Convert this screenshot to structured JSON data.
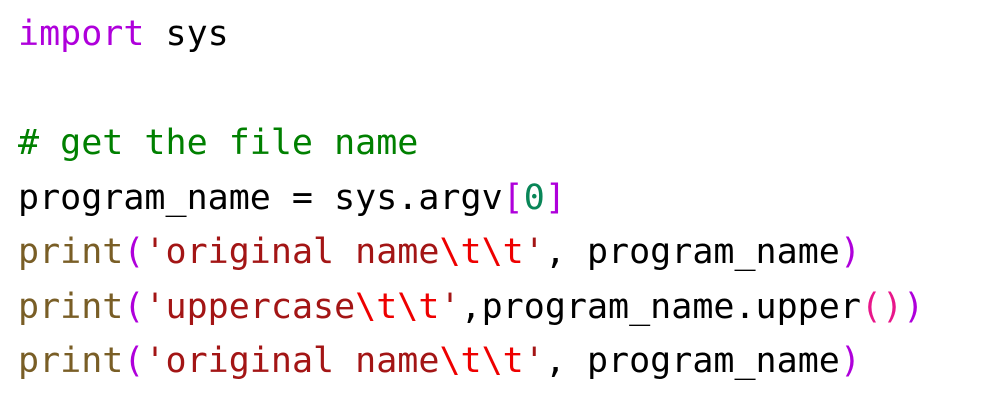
{
  "colors": {
    "background": "#ffffff",
    "default": "#000000",
    "keyword": "#af00db",
    "builtin": "#795e26",
    "string": "#a31515",
    "escape": "#ee0000",
    "comment": "#008000",
    "number": "#098658",
    "bracket_level1": "#af00db",
    "bracket_level2": "#e8178a",
    "partial_line": "#bfbfbf"
  },
  "lines": [
    {
      "tokens": [
        {
          "text": "import",
          "type": "keyword"
        },
        {
          "text": " sys",
          "type": "default"
        }
      ]
    },
    {
      "tokens": []
    },
    {
      "tokens": [
        {
          "text": "# get the file name",
          "type": "comment"
        }
      ]
    },
    {
      "tokens": [
        {
          "text": "program_name = sys.argv",
          "type": "default"
        },
        {
          "text": "[",
          "type": "bracket_level1"
        },
        {
          "text": "0",
          "type": "number"
        },
        {
          "text": "]",
          "type": "bracket_level1"
        }
      ]
    },
    {
      "tokens": [
        {
          "text": "print",
          "type": "builtin"
        },
        {
          "text": "(",
          "type": "bracket_level1"
        },
        {
          "text": "'original name",
          "type": "string"
        },
        {
          "text": "\\t\\t",
          "type": "escape"
        },
        {
          "text": "'",
          "type": "string"
        },
        {
          "text": ", program_name",
          "type": "default"
        },
        {
          "text": ")",
          "type": "bracket_level1"
        }
      ]
    },
    {
      "tokens": [
        {
          "text": "print",
          "type": "builtin"
        },
        {
          "text": "(",
          "type": "bracket_level1"
        },
        {
          "text": "'uppercase",
          "type": "string"
        },
        {
          "text": "\\t\\t",
          "type": "escape"
        },
        {
          "text": "'",
          "type": "string"
        },
        {
          "text": ",program_name.upper",
          "type": "default"
        },
        {
          "text": "()",
          "type": "bracket_level2"
        },
        {
          "text": ")",
          "type": "bracket_level1"
        }
      ]
    },
    {
      "tokens": [
        {
          "text": "print",
          "type": "builtin"
        },
        {
          "text": "(",
          "type": "bracket_level1"
        },
        {
          "text": "'original name",
          "type": "string"
        },
        {
          "text": "\\t\\t",
          "type": "escape"
        },
        {
          "text": "'",
          "type": "string"
        },
        {
          "text": ", program_name",
          "type": "default"
        },
        {
          "text": ")",
          "type": "bracket_level1"
        }
      ]
    }
  ]
}
